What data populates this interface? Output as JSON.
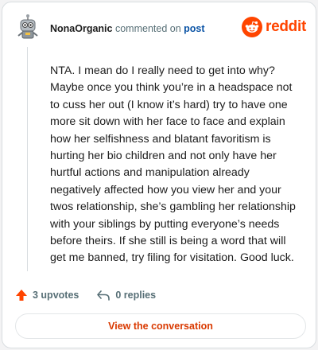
{
  "header": {
    "username": "NonaOrganic",
    "action_text": "commented on",
    "post_link": "post",
    "brand": "reddit"
  },
  "comment": {
    "text": "NTA. I mean do I really need to get into why? Maybe once you think you’re in a headspace not to cuss her out (I know it’s hard) try to have one more sit down with her face to face and explain how her selfishness and blatant favoritism is hurting her bio children and not only have her hurtful actions and manipulation already negatively affected how you view her and your twos relationship, she’s gambling her relationship with your siblings by putting everyone’s needs before theirs. If she still is being a word that will get me banned, try filing for visitation. Good luck."
  },
  "actions": {
    "upvotes_label": "3 upvotes",
    "replies_label": "0 replies"
  },
  "cta": {
    "label": "View the conversation"
  },
  "colors": {
    "brand": "#ff4500",
    "upvote": "#ff4500",
    "link": "#0a53a5",
    "cta_text": "#d93900"
  },
  "icons": {
    "avatar": "robot-avatar",
    "brand": "reddit-snoo-icon",
    "upvote": "upvote-arrow-icon",
    "reply": "reply-arrow-icon"
  }
}
